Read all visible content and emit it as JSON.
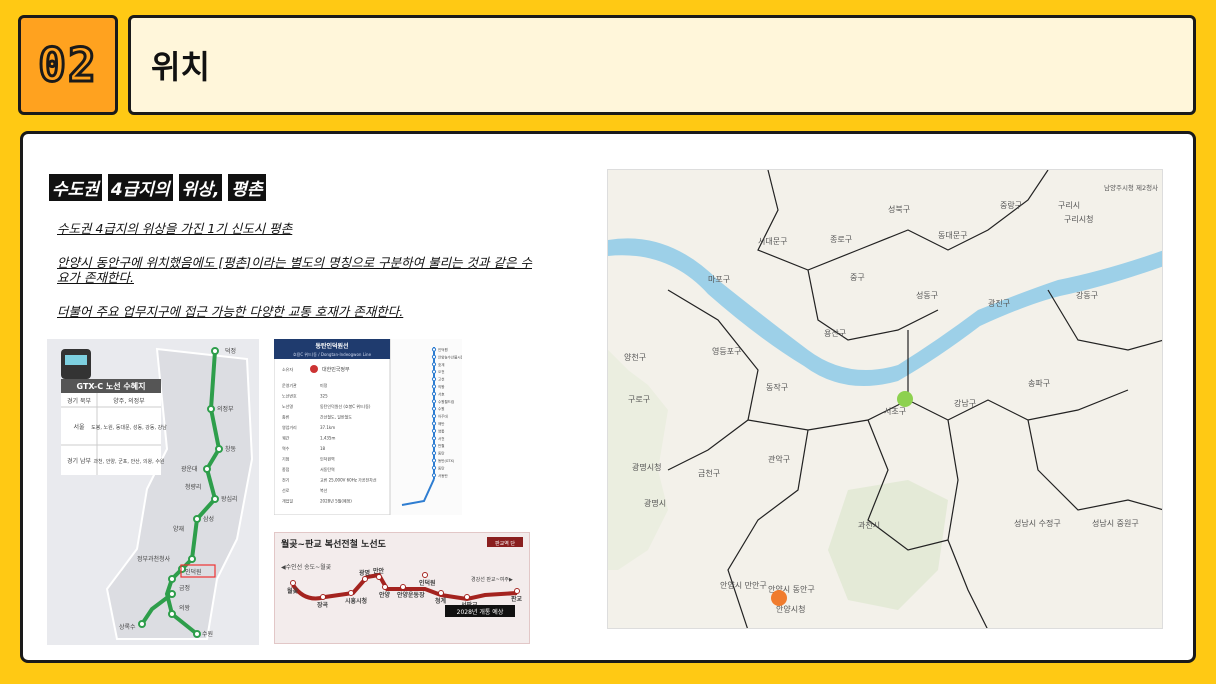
{
  "section": {
    "number": "02",
    "title": "위치"
  },
  "heading": {
    "parts": [
      "수도권",
      "4급지의",
      "위상,",
      "평촌"
    ]
  },
  "paragraphs": [
    "수도권 4급지의 위상을 가진 1기 신도시 평촌",
    "안양시 동안구에 위치했음에도 [평촌]이라는 별도의 명칭으로 구분하여 불리는 것과 같은 수요가 존재한다.",
    "더불어 주요 업무지구에 접근 가능한 다양한 교통 호재가 존재한다."
  ],
  "gtx_map": {
    "table_title": "GTX-C 노선 수혜지",
    "rows": [
      {
        "region": "경기 북부",
        "cities": "양주, 의정부"
      },
      {
        "region": "서울",
        "cities": "도봉, 노원, 동대문, 성동, 강동, 강남"
      },
      {
        "region": "경기 남부",
        "cities": "과천, 안양, 군포, 안산, 의왕, 수원"
      }
    ],
    "stations": [
      "덕정",
      "의정부",
      "창동",
      "광운대",
      "청량리",
      "왕십리",
      "삼성",
      "양재",
      "정부과천청사",
      "인덕원",
      "금정",
      "의왕",
      "상록수",
      "수원"
    ]
  },
  "dongtan_line": {
    "title": "동탄인덕원선",
    "subtitle": "호용C 위드)동 / Dongtan-Indeogwon Line",
    "owner_label": "소유자",
    "owner": "대한민국정부",
    "rows": [
      {
        "k": "운영기관",
        "v": "미정"
      },
      {
        "k": "노선번호",
        "v": "325"
      },
      {
        "k": "노선명",
        "v": "동탄인덕원선 (호봉C 위드)동)"
      },
      {
        "k": "종류",
        "v": "간선철도, 일반철도"
      },
      {
        "k": "영업거리",
        "v": "37.1km"
      },
      {
        "k": "궤간",
        "v": "1,435m"
      },
      {
        "k": "역수",
        "v": "18"
      },
      {
        "k": "기점",
        "v": "인덕원역"
      },
      {
        "k": "종점",
        "v": "서동탄역"
      },
      {
        "k": "전기",
        "v": "교류 25,000V 60Hz 가공전차선"
      },
      {
        "k": "선로",
        "v": "복선"
      },
      {
        "k": "개업일",
        "v": "2028년 5월(예정)"
      }
    ],
    "station_labels": [
      "인덕원",
      "안양농수산물시장",
      "호계",
      "오전",
      "고천",
      "의왕",
      "서호",
      "수원월드컵",
      "수원",
      "아주대",
      "매탄",
      "영통",
      "서천",
      "반월",
      "동탄",
      "동탄(GTX)",
      "동탄",
      "서동탄"
    ]
  },
  "wolgot": {
    "title": "월곶~판교 복선전철 노선도",
    "badge": "판교역 단",
    "note_left": "◀수인선 송도~월곶",
    "note_right": "경강선 판교~여주▶",
    "stations": [
      "월곶",
      "장곡",
      "시흥시청",
      "광명",
      "만안",
      "안양",
      "안양운동장",
      "인덕원",
      "청계",
      "서판교",
      "판교"
    ],
    "open_label": "2028년 개통 예상"
  },
  "seoul_map": {
    "labels": [
      "성북구",
      "중랑구",
      "구리시",
      "남양주시청 제2청사",
      "서대문구",
      "종로구",
      "동대문구",
      "구리시청",
      "마포구",
      "중구",
      "성동구",
      "광진구",
      "강동구",
      "양천구",
      "영등포구",
      "용산구",
      "동작구",
      "구로구",
      "서초구",
      "강남구",
      "송파구",
      "관악구",
      "금천구",
      "광명시청",
      "광명시",
      "과천시",
      "성남시 수정구",
      "성남시 중원구",
      "안양시 만안구",
      "안양시 동안구",
      "안양시청"
    ],
    "markers": [
      {
        "name": "서초구",
        "color": "#8DD14F"
      },
      {
        "name": "안양시 동안구",
        "color": "#F07C2E"
      }
    ]
  }
}
